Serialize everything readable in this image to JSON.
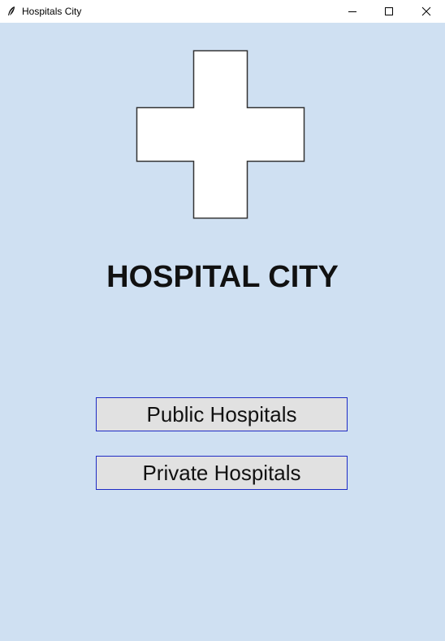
{
  "window": {
    "title": "Hospitals City",
    "icons": {
      "app": "feather-icon",
      "minimize": "minimize-icon",
      "maximize": "maximize-icon",
      "close": "close-icon"
    }
  },
  "main": {
    "logo": "medical-cross-icon",
    "heading": "HOSPITAL CITY",
    "buttons": {
      "public_label": "Public Hospitals",
      "private_label": "Private Hospitals"
    }
  },
  "colors": {
    "background": "#cfe0f2",
    "button_face": "#e1e1e1",
    "button_border": "#1f2bc4",
    "cross_fill": "#ffffff"
  }
}
